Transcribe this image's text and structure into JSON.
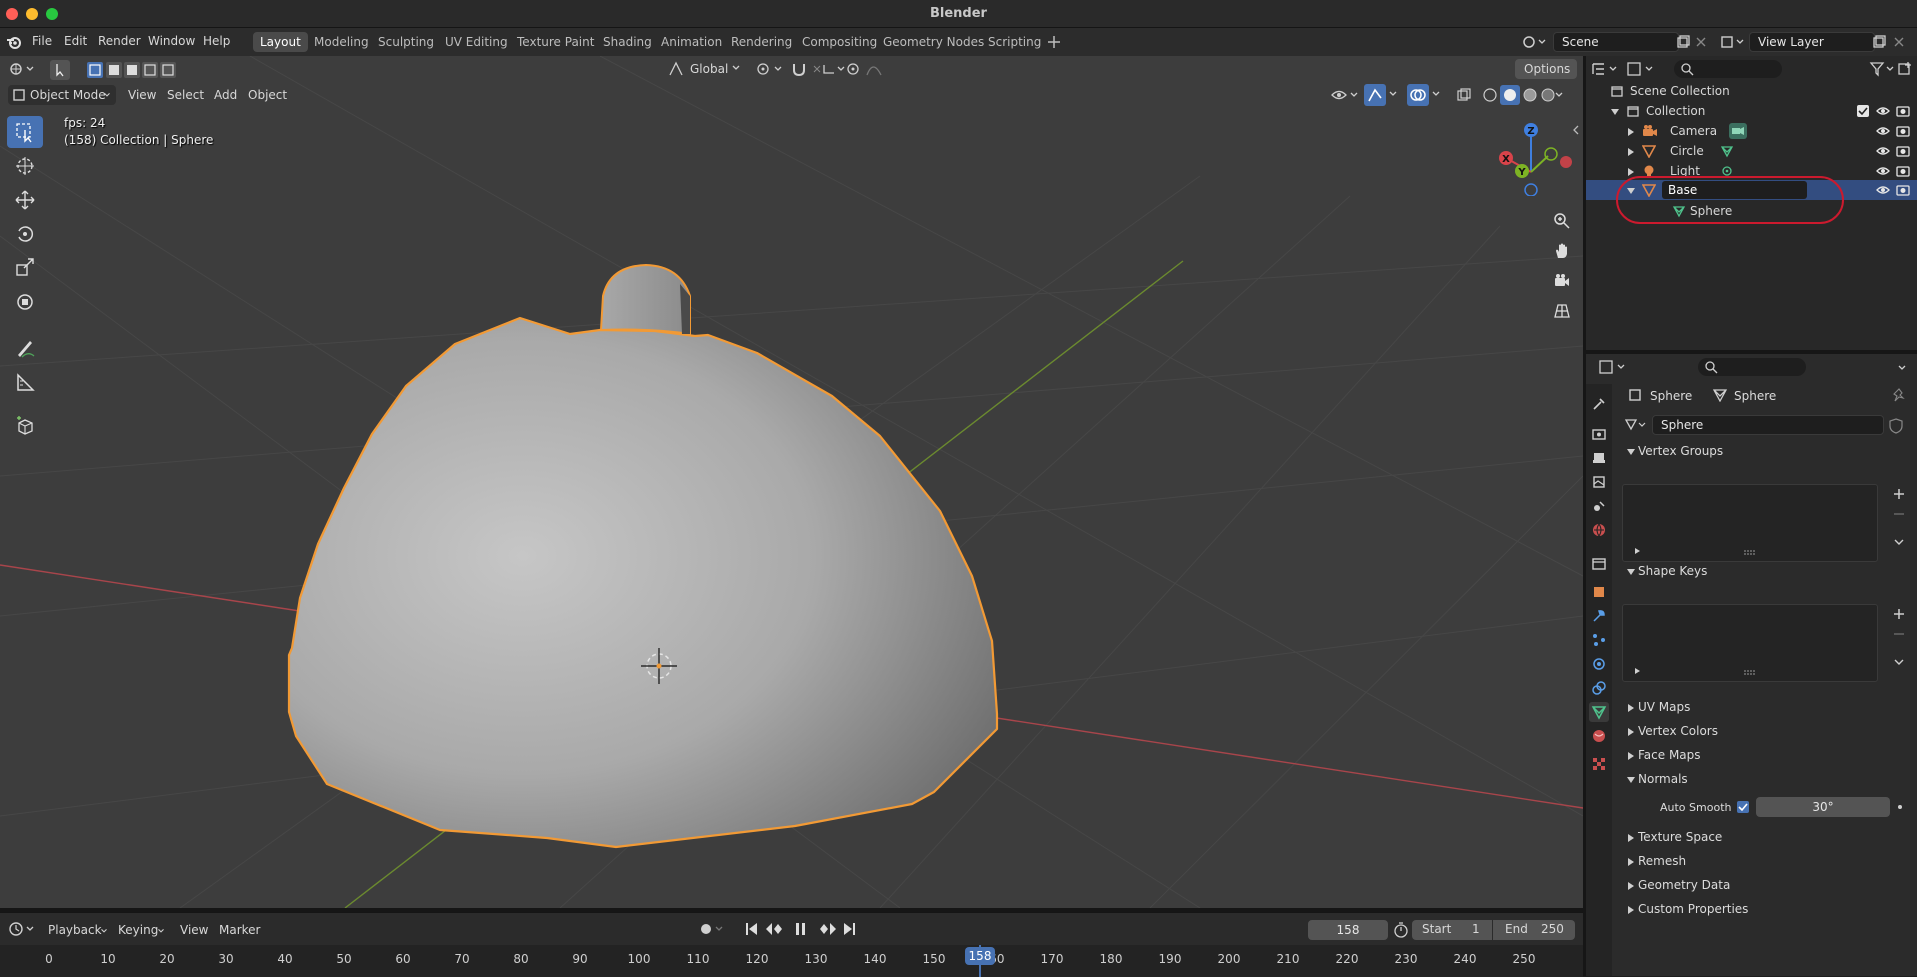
{
  "window": {
    "title": "Blender"
  },
  "menu": [
    "File",
    "Edit",
    "Render",
    "Window",
    "Help"
  ],
  "workspaces": [
    "Layout",
    "Modeling",
    "Sculpting",
    "UV Editing",
    "Texture Paint",
    "Shading",
    "Animation",
    "Rendering",
    "Compositing",
    "Geometry Nodes",
    "Scripting"
  ],
  "active_workspace": "Layout",
  "scene": {
    "name": "Scene",
    "view_layer": "View Layer"
  },
  "viewport": {
    "transform_orientation": "Global",
    "options_label": "Options",
    "mode": "Object Mode",
    "header_menus": [
      "View",
      "Select",
      "Add",
      "Object"
    ],
    "fps_text": "fps: 24",
    "info_text": "(158) Collection | Sphere",
    "gizmo_labels": {
      "x": "X",
      "y": "Y",
      "z": "Z"
    }
  },
  "timeline": {
    "menus": [
      "Playback",
      "Keying",
      "View",
      "Marker"
    ],
    "current_frame": "158",
    "start_label": "Start",
    "start": "1",
    "end_label": "End",
    "end": "250",
    "ticks": [
      "0",
      "10",
      "20",
      "30",
      "40",
      "50",
      "60",
      "70",
      "80",
      "90",
      "100",
      "110",
      "120",
      "130",
      "140",
      "150",
      "160",
      "170",
      "180",
      "190",
      "200",
      "210",
      "220",
      "230",
      "240",
      "250"
    ],
    "playhead_label": "158"
  },
  "outliner": {
    "scene_collection": "Scene Collection",
    "collection": "Collection",
    "items": [
      "Camera",
      "Circle",
      "Light",
      "Base"
    ],
    "child": "Sphere",
    "selected": "Base",
    "colors": {
      "highlight": "#334d80",
      "annotation": "#cc1a2e"
    }
  },
  "properties": {
    "breadcrumb_object": "Sphere",
    "breadcrumb_data": "Sphere",
    "data_name": "Sphere",
    "sections": {
      "vertex_groups": "Vertex Groups",
      "shape_keys": "Shape Keys",
      "uv_maps": "UV Maps",
      "vertex_colors": "Vertex Colors",
      "face_maps": "Face Maps",
      "normals": "Normals",
      "auto_smooth_label": "Auto Smooth",
      "auto_smooth_angle": "30°",
      "auto_smooth_checked": true,
      "texture_space": "Texture Space",
      "remesh": "Remesh",
      "geometry_data": "Geometry Data",
      "custom_properties": "Custom Properties"
    }
  },
  "colors": {
    "selection_outline": "#f29a35",
    "accent_blue": "#4772b3",
    "axis_x": "#d9434a",
    "axis_y": "#7db324",
    "axis_z": "#3f7fe0",
    "viewport_bg": "#3d3d3d"
  }
}
